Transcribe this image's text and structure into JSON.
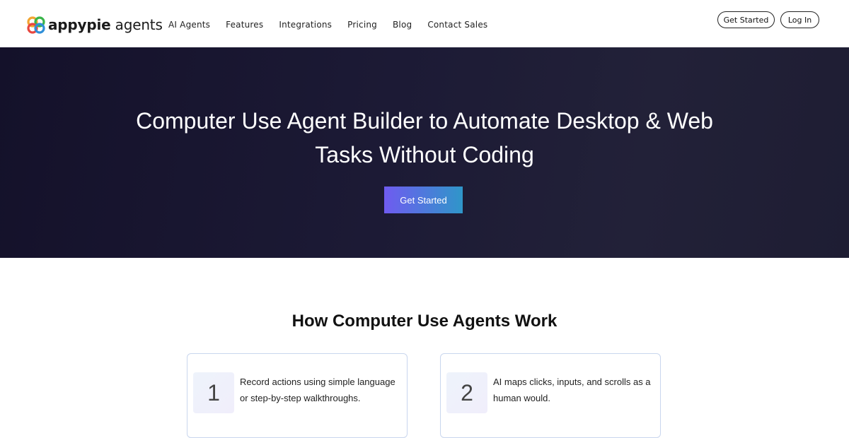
{
  "header": {
    "logo": {
      "brand": "appypie",
      "suffix": " agents"
    },
    "nav": [
      {
        "label": "AI Agents"
      },
      {
        "label": "Features"
      },
      {
        "label": "Integrations"
      },
      {
        "label": "Pricing"
      },
      {
        "label": "Blog"
      },
      {
        "label": "Contact Sales"
      }
    ],
    "get_started_label": "Get Started",
    "login_label": "Log In"
  },
  "hero": {
    "title_line1": "Computer Use Agent Builder to Automate Desktop & Web",
    "title_line2": "Tasks Without Coding",
    "cta_label": "Get Started"
  },
  "how_it_works": {
    "title": "How Computer Use Agents Work",
    "steps": [
      {
        "number": "1",
        "text": "Record actions using simple language or step-by-step walkthroughs."
      },
      {
        "number": "2",
        "text": "AI maps clicks, inputs, and scrolls as a human would."
      }
    ]
  },
  "colors": {
    "hero_bg": "#1a1830",
    "cta_gradient_start": "#6f5bf0",
    "cta_gradient_end": "#2f96c9",
    "card_border": "#c9d6ee"
  },
  "icons": {
    "logo": "appypie-logo-icon"
  }
}
